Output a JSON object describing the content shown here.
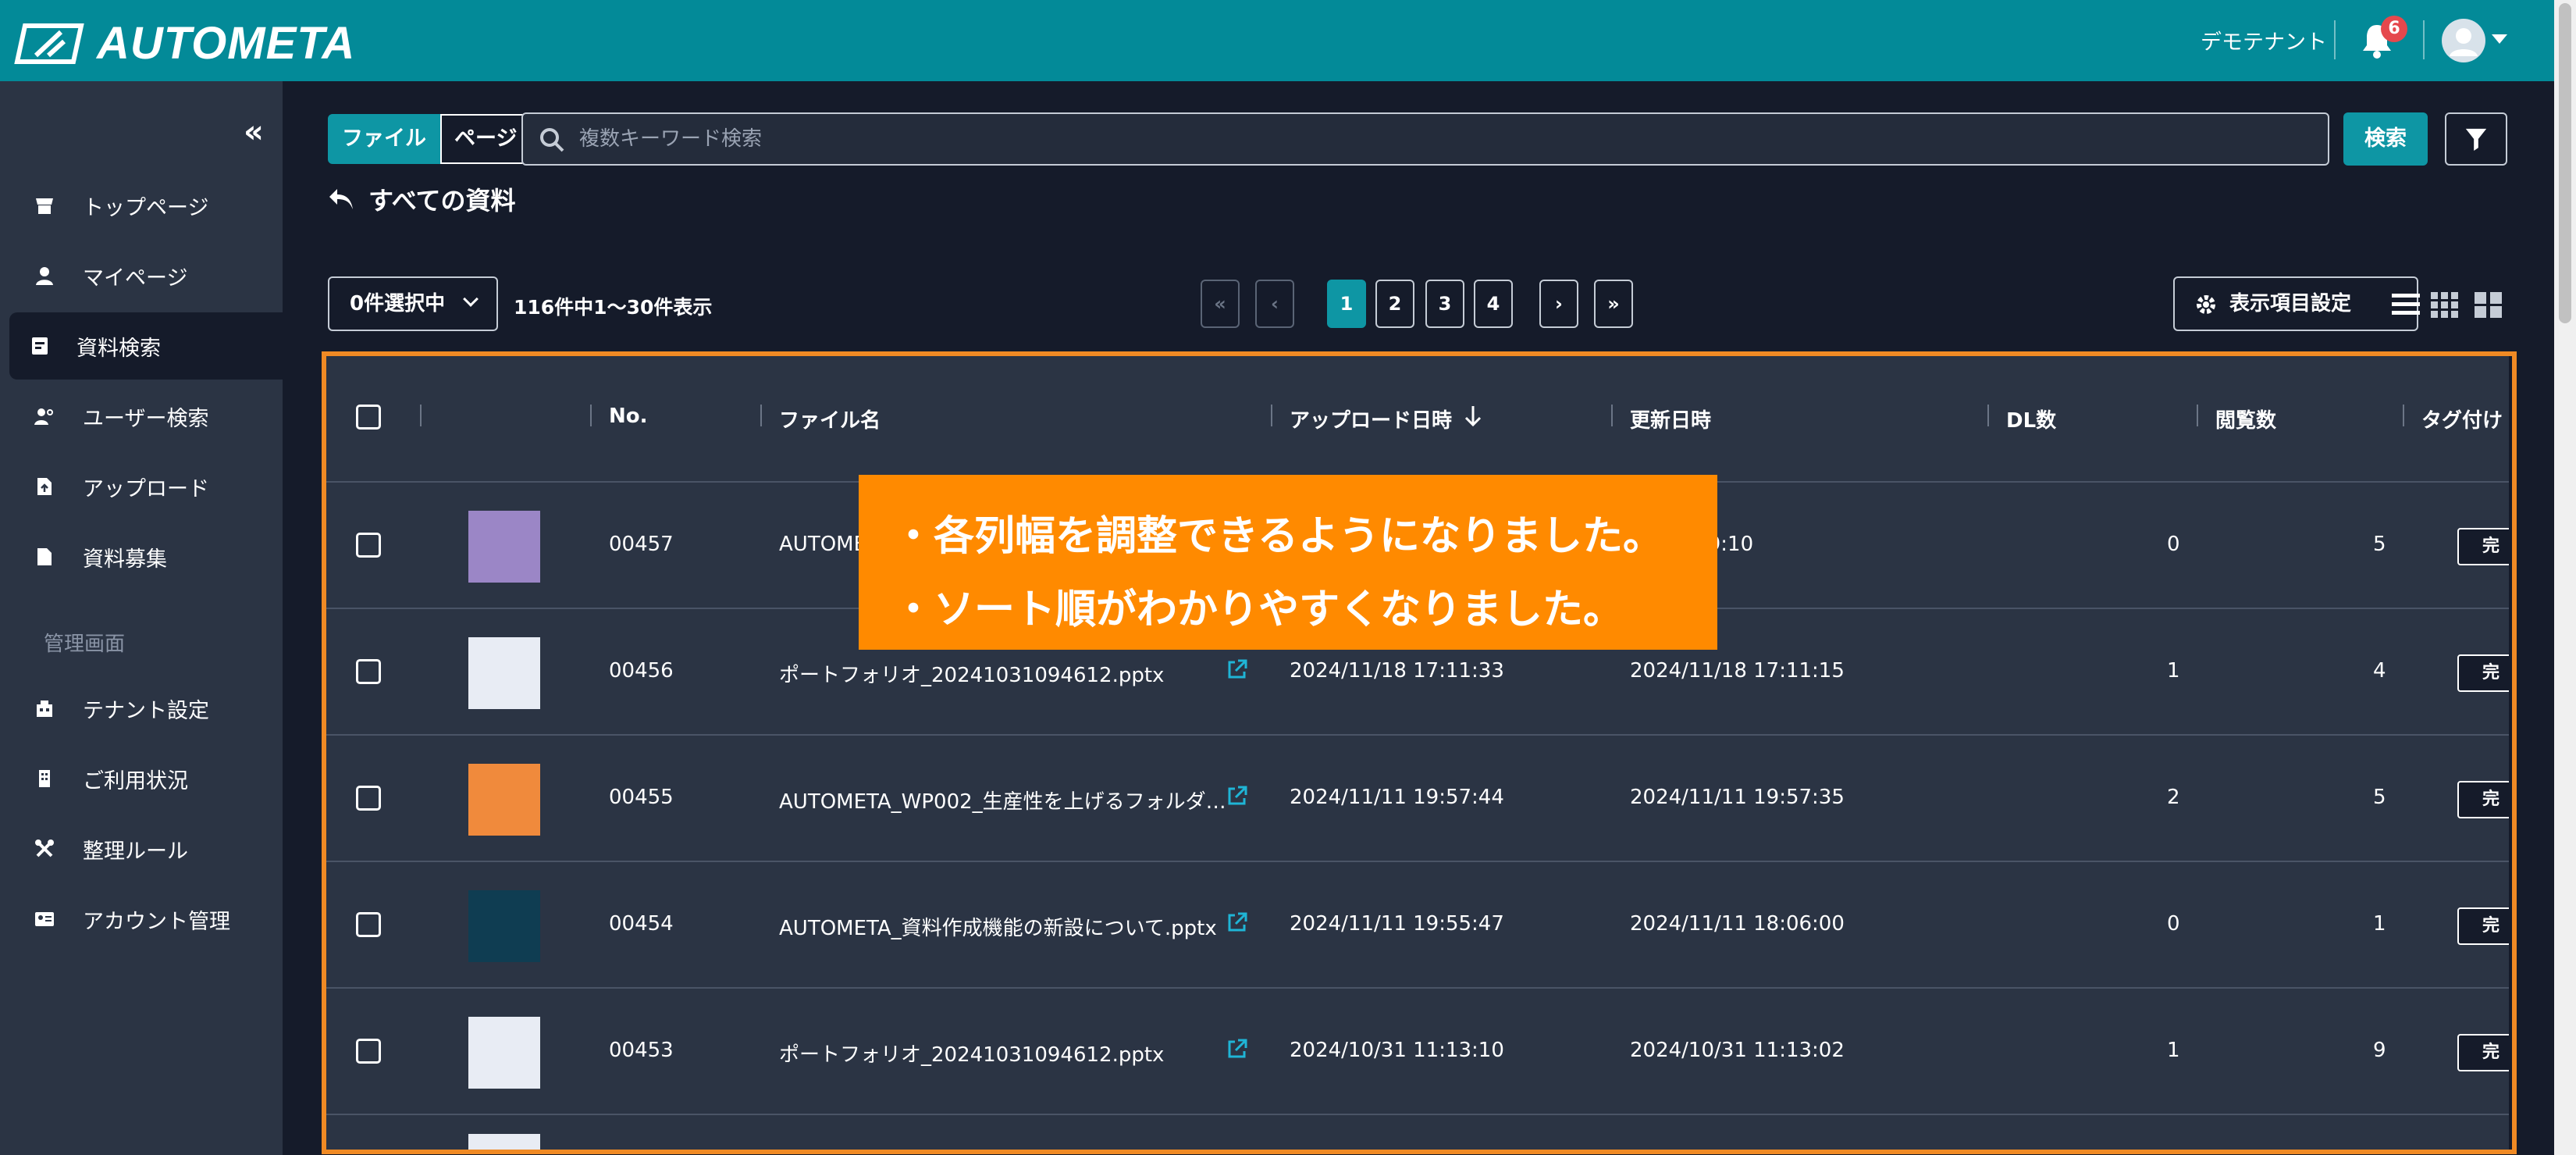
{
  "app": {
    "brand": "AUTOMETA"
  },
  "header": {
    "tenant": "デモテナント",
    "notification_count": "6"
  },
  "sidebar": {
    "items": [
      {
        "label": "トップページ",
        "icon": "store-icon"
      },
      {
        "label": "マイページ",
        "icon": "user-icon"
      },
      {
        "label": "資料検索",
        "icon": "document-search-icon",
        "active": true
      },
      {
        "label": "ユーザー検索",
        "icon": "user-search-icon"
      },
      {
        "label": "アップロード",
        "icon": "upload-file-icon"
      },
      {
        "label": "資料募集",
        "icon": "file-icon"
      }
    ],
    "admin_section": "管理画面",
    "admin_items": [
      {
        "label": "テナント設定",
        "icon": "building-icon"
      },
      {
        "label": "ご利用状況",
        "icon": "office-icon"
      },
      {
        "label": "整理ルール",
        "icon": "tools-icon"
      },
      {
        "label": "アカウント管理",
        "icon": "id-card-icon"
      }
    ]
  },
  "search": {
    "mode_file": "ファイル",
    "mode_page": "ページ",
    "placeholder": "複数キーワード検索",
    "button": "検索"
  },
  "page": {
    "title": "すべての資料"
  },
  "toolbar": {
    "selected": "0件選択中",
    "count": "116件中1〜30件表示",
    "pages": [
      "1",
      "2",
      "3",
      "4"
    ],
    "current_page": "1",
    "display_settings": "表示項目設定"
  },
  "table": {
    "columns": [
      "No.",
      "ファイル名",
      "アップロード日時",
      "更新日時",
      "DL数",
      "閲覧数",
      "タグ付け"
    ],
    "sort_column": "アップロード日時",
    "rows": [
      {
        "no": "00457",
        "name": "AUTOME",
        "uploaded": "",
        "updated": "10 19:29:10",
        "dl": "0",
        "views": "5",
        "tag": "完"
      },
      {
        "no": "00456",
        "name": "ポートフォリオ_20241031094612.pptx",
        "uploaded": "2024/11/18 17:11:33",
        "updated": "2024/11/18 17:11:15",
        "dl": "1",
        "views": "4",
        "tag": "完"
      },
      {
        "no": "00455",
        "name": "AUTOMETA_WP002_生産性を上げるフォルダ…",
        "uploaded": "2024/11/11 19:57:44",
        "updated": "2024/11/11 19:57:35",
        "dl": "2",
        "views": "5",
        "tag": "完"
      },
      {
        "no": "00454",
        "name": "AUTOMETA_資料作成機能の新設について.pptx",
        "uploaded": "2024/11/11 19:55:47",
        "updated": "2024/11/11 18:06:00",
        "dl": "0",
        "views": "1",
        "tag": "完"
      },
      {
        "no": "00453",
        "name": "ポートフォリオ_20241031094612.pptx",
        "uploaded": "2024/10/31 11:13:10",
        "updated": "2024/10/31 11:13:02",
        "dl": "1",
        "views": "9",
        "tag": "完"
      }
    ]
  },
  "callout": {
    "line1": "・各列幅を調整できるようになりました。",
    "line2": "・ソート順がわかりやすくなりました。"
  },
  "colors": {
    "header": "#038a98",
    "accent": "#0e96a4",
    "highlight": "#f08a24",
    "callout": "#ff8a00"
  }
}
